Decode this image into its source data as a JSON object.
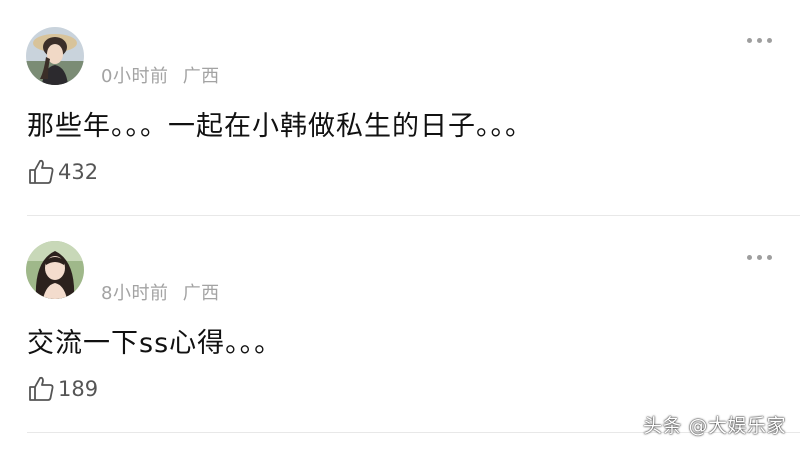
{
  "comments": [
    {
      "time": "0小时前",
      "location": "广西",
      "text": "那些年。。。一起在小韩做私生的日子。。。",
      "likes": "432",
      "avatar": "avatar-woman-straw-hat"
    },
    {
      "time": "8小时前",
      "location": "广西",
      "text": "交流一下ss心得。。。",
      "likes": "189",
      "avatar": "avatar-woman-long-hair"
    }
  ],
  "icons": {
    "like": "thumbs-up-icon",
    "more": "more-options-icon"
  },
  "watermark": "头条 @大娱乐家",
  "colors": {
    "text": "#111111",
    "meta": "#a3a3a3",
    "divider": "#e8e8e8"
  }
}
